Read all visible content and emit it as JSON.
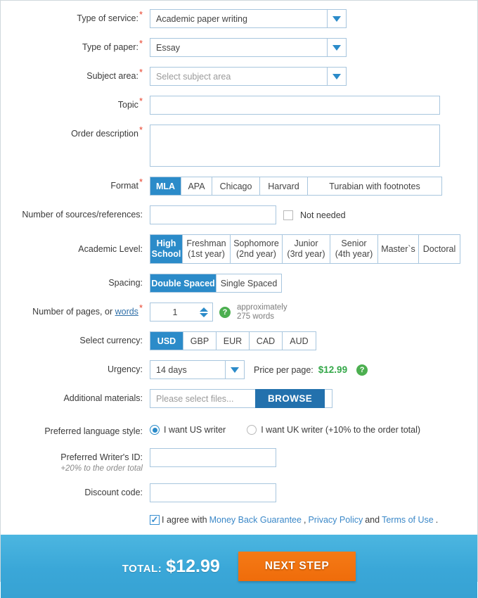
{
  "form": {
    "service": {
      "label": "Type of service:",
      "value": "Academic paper writing",
      "required": true
    },
    "paper": {
      "label": "Type of paper:",
      "value": "Essay",
      "required": true
    },
    "subject": {
      "label": "Subject area:",
      "placeholder": "Select subject area",
      "required": true
    },
    "topic": {
      "label": "Topic",
      "value": "",
      "required": true
    },
    "description": {
      "label": "Order description",
      "value": "",
      "required": true
    },
    "format": {
      "label": "Format",
      "required": true,
      "options": [
        "MLA",
        "APA",
        "Chicago",
        "Harvard",
        "Turabian with footnotes"
      ],
      "selected": "MLA"
    },
    "sources": {
      "label": "Number of sources/references:",
      "value": "",
      "not_needed_label": "Not needed",
      "not_needed_checked": false
    },
    "academic_level": {
      "label": "Academic Level:",
      "options": [
        {
          "line1": "High",
          "line2": "School"
        },
        {
          "line1": "Freshman",
          "line2": "(1st year)"
        },
        {
          "line1": "Sophomore",
          "line2": "(2nd year)"
        },
        {
          "line1": "Junior",
          "line2": "(3rd year)"
        },
        {
          "line1": "Senior",
          "line2": "(4th year)"
        },
        {
          "line1": "Master`s",
          "line2": ""
        },
        {
          "line1": "Doctoral",
          "line2": ""
        }
      ],
      "selected_index": 0
    },
    "spacing": {
      "label": "Spacing:",
      "options": [
        "Double Spaced",
        "Single Spaced"
      ],
      "selected": "Double Spaced"
    },
    "pages": {
      "label_prefix": "Number of pages, or ",
      "label_link": "words",
      "required": true,
      "value": "1",
      "help_icon": "help-icon",
      "note_line1": "approximately",
      "note_line2": "275 words"
    },
    "currency": {
      "label": "Select currency:",
      "options": [
        "USD",
        "GBP",
        "EUR",
        "CAD",
        "AUD"
      ],
      "selected": "USD"
    },
    "urgency": {
      "label": "Urgency:",
      "value": "14 days",
      "price_label": "Price per page:",
      "price_value": "$12.99",
      "help_icon": "help-icon"
    },
    "materials": {
      "label": "Additional materials:",
      "placeholder": "Please select files...",
      "browse_label": "BROWSE"
    },
    "language_style": {
      "label": "Preferred language style:",
      "options": [
        {
          "text": "I want US writer",
          "selected": true
        },
        {
          "text": "I want UK writer (+10% to the order total)",
          "selected": false
        }
      ]
    },
    "writer_id": {
      "label": "Preferred Writer's ID:",
      "note": "+20% to the order total",
      "value": ""
    },
    "discount": {
      "label": "Discount code:",
      "value": ""
    },
    "agreement": {
      "checked": true,
      "prefix": "I agree with ",
      "link1": "Money Back Guarantee",
      "sep1": ", ",
      "link2": "Privacy Policy",
      "sep2": " and ",
      "link3": "Terms of Use",
      "suffix": "."
    }
  },
  "footer": {
    "total_label": "TOTAL:",
    "total_amount": "$12.99",
    "next_label": "NEXT STEP"
  },
  "colors": {
    "accent_blue": "#2b8bc9",
    "browse_blue": "#2371ad",
    "green": "#4caf50",
    "orange": "#ef6c0a",
    "required_red": "#e8402a",
    "link_blue": "#3b88c8"
  }
}
